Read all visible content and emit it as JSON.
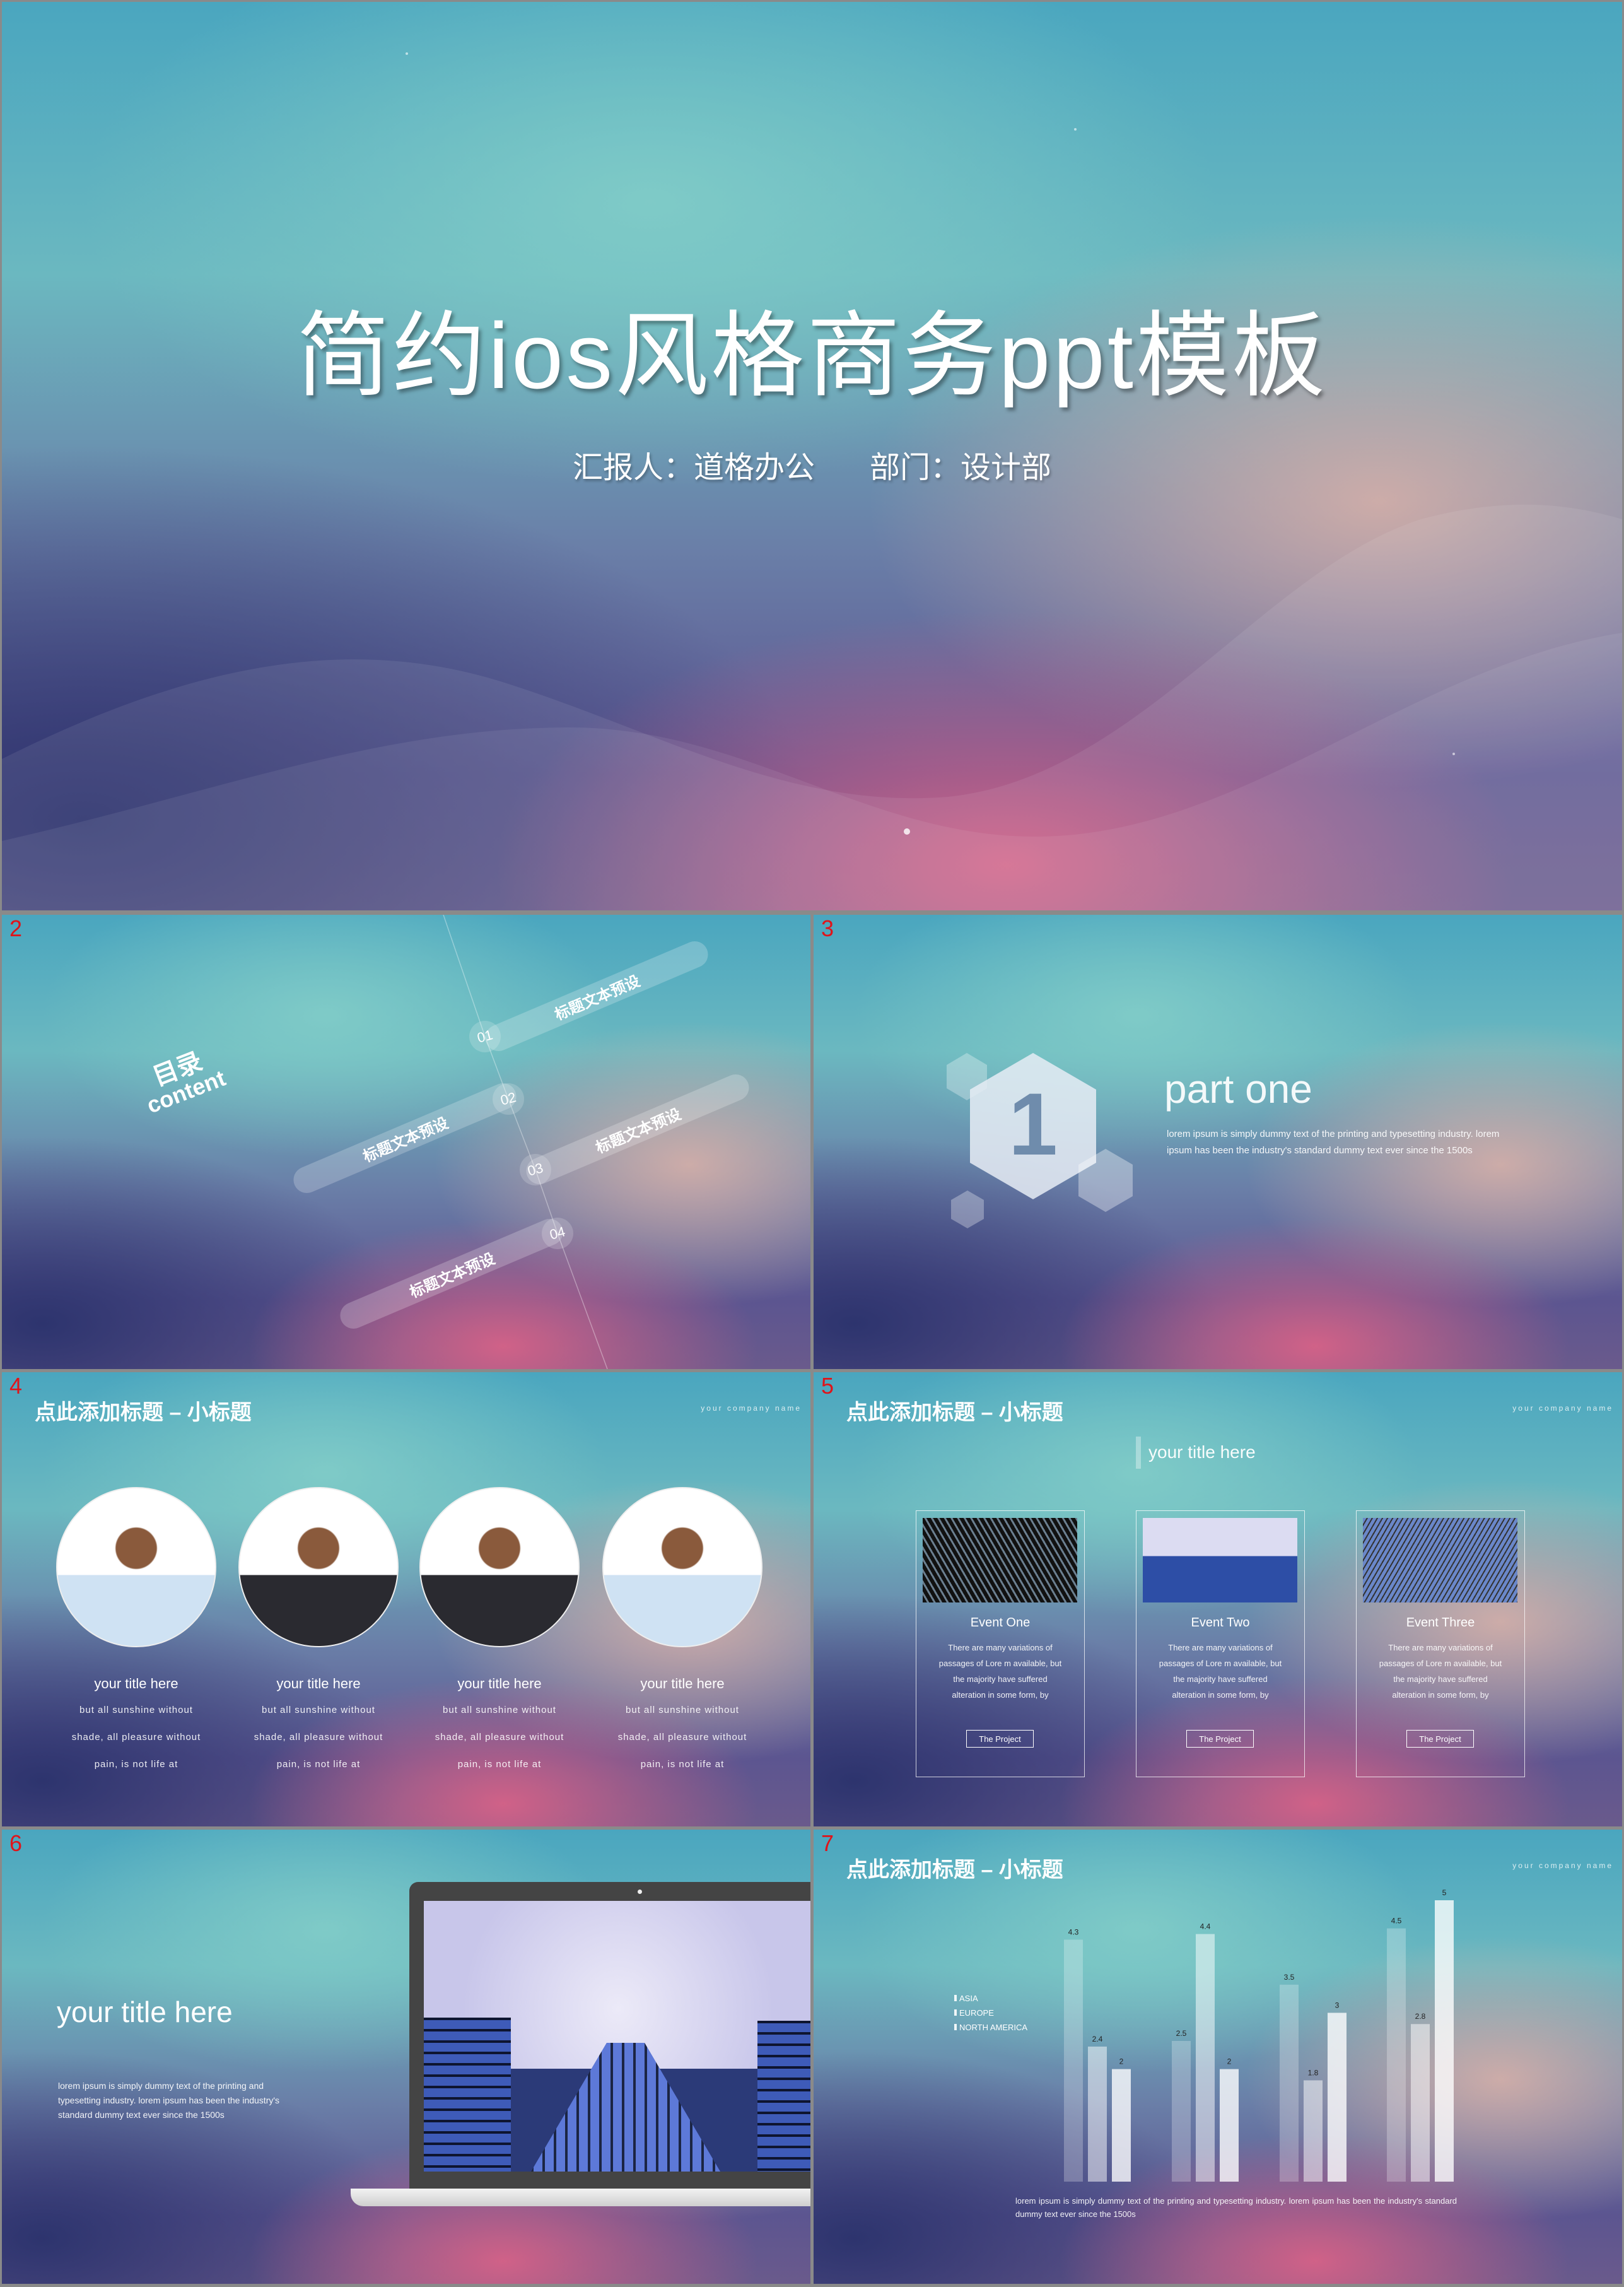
{
  "slides": {
    "s1": {
      "title": "简约ios风格商务ppt模板",
      "reporter": "汇报人：道格办公",
      "department": "部门：设计部"
    },
    "s2": {
      "number": "2",
      "heading_cn": "目录",
      "heading_en": "content",
      "items": [
        {
          "num": "01",
          "label": "标题文本预设"
        },
        {
          "num": "02",
          "label": "标题文本预设"
        },
        {
          "num": "03",
          "label": "标题文本预设"
        },
        {
          "num": "04",
          "label": "标题文本预设"
        }
      ]
    },
    "s3": {
      "number": "3",
      "badge": "1",
      "title": "part one",
      "body": "lorem ipsum is simply dummy text of the printing and typesetting industry. lorem ipsum has been the industry's standard dummy text ever since the 1500s"
    },
    "s4": {
      "number": "4",
      "title": "点此添加标题 – 小标题",
      "company": "your company name",
      "people": [
        {
          "title": "your title here",
          "lines": [
            "but all sunshine without",
            "shade, all pleasure without",
            "pain, is not life at"
          ]
        },
        {
          "title": "your title here",
          "lines": [
            "but all sunshine without",
            "shade, all pleasure without",
            "pain, is not life at"
          ]
        },
        {
          "title": "your title here",
          "lines": [
            "but all sunshine without",
            "shade, all pleasure without",
            "pain, is not life at"
          ]
        },
        {
          "title": "your title here",
          "lines": [
            "but all sunshine without",
            "shade, all pleasure without",
            "pain, is not life at"
          ]
        }
      ]
    },
    "s5": {
      "number": "5",
      "title": "点此添加标题 – 小标题",
      "company": "your company name",
      "subtitle": "your title here",
      "cards": [
        {
          "title": "Event One",
          "lines": [
            "There are many variations of",
            "passages of Lore m available, but",
            "the majority have suffered",
            "alteration in some form, by"
          ],
          "button": "The Project"
        },
        {
          "title": "Event Two",
          "lines": [
            "There are many variations of",
            "passages of Lore m available, but",
            "the majority have suffered",
            "alteration in some form, by"
          ],
          "button": "The Project"
        },
        {
          "title": "Event Three",
          "lines": [
            "There are many variations of",
            "passages of Lore m available, but",
            "the majority have suffered",
            "alteration in some form, by"
          ],
          "button": "The Project"
        }
      ]
    },
    "s6": {
      "number": "6",
      "title": "your title here",
      "body": "lorem ipsum is simply dummy text of the printing and typesetting industry. lorem ipsum has been the industry's standard dummy text ever since the 1500s"
    },
    "s7": {
      "number": "7",
      "title": "点此添加标题 – 小标题",
      "company": "your company name",
      "caption": "lorem ipsum is simply dummy text of the printing and typesetting industry. lorem ipsum has been the industry's standard dummy text ever since the 1500s"
    }
  },
  "chart_data": {
    "type": "bar",
    "categories": [
      "",
      "",
      "",
      ""
    ],
    "series": [
      {
        "name": "ASIA",
        "values": [
          4.3,
          2.5,
          3.5,
          4.5
        ]
      },
      {
        "name": "EUROPE",
        "values": [
          2.4,
          4.4,
          1.8,
          2.8
        ]
      },
      {
        "name": "NORTH AMERICA",
        "values": [
          2,
          2,
          3,
          5
        ]
      }
    ],
    "ylim": [
      0,
      5
    ],
    "grid": false,
    "legend": "left",
    "data_labels": true,
    "colors": [
      "rgba(255,255,255,0.25)",
      "rgba(255,255,255,0.5)",
      "rgba(255,255,255,0.78)"
    ]
  }
}
